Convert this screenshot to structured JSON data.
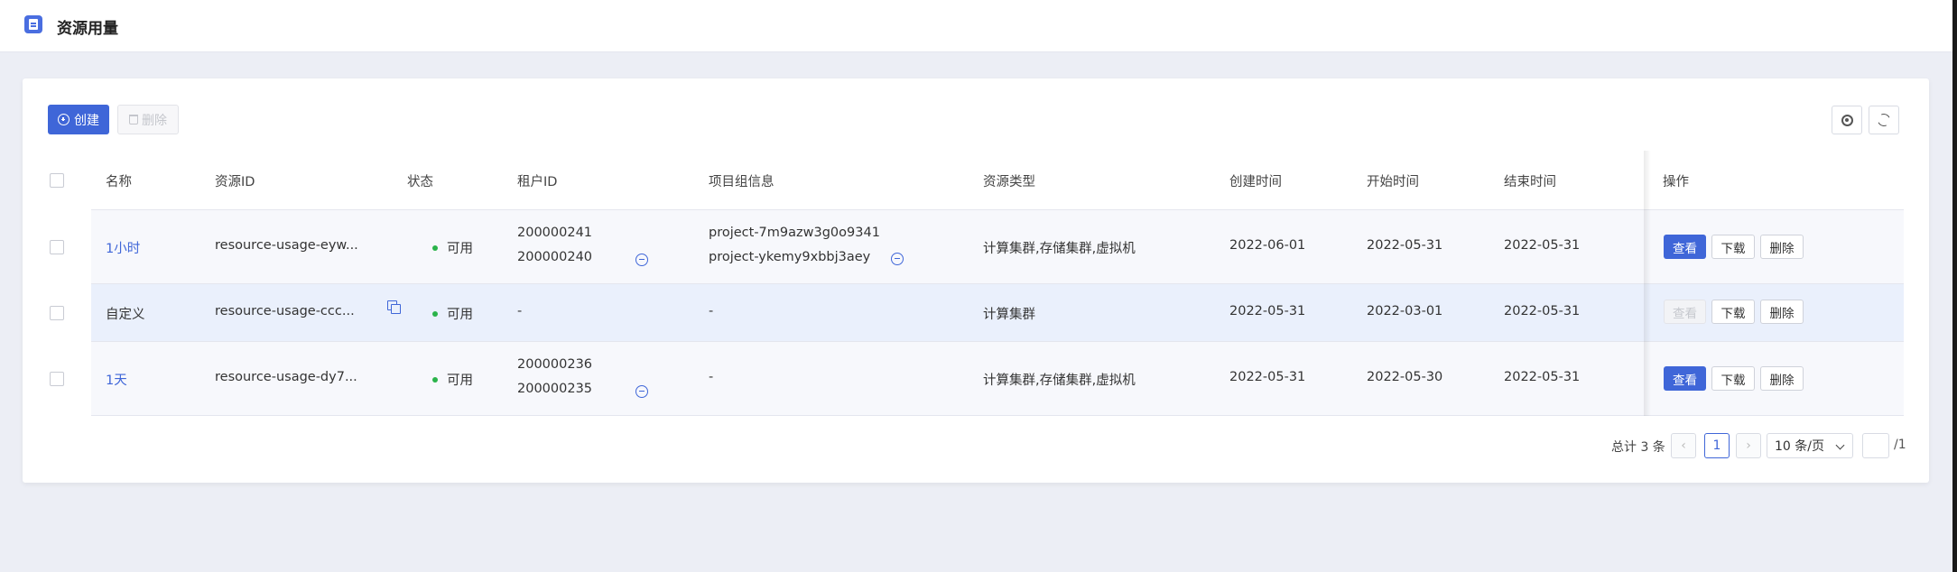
{
  "header": {
    "title": "资源用量"
  },
  "toolbar": {
    "create_label": "创建",
    "delete_label": "删除"
  },
  "columns": [
    "名称",
    "资源ID",
    "状态",
    "租户ID",
    "项目组信息",
    "资源类型",
    "创建时间",
    "开始时间",
    "结束时间",
    "操作"
  ],
  "rows": [
    {
      "name": "1小时",
      "resource_id": "resource-usage-eyw...",
      "status": "可用",
      "tenant_ids": [
        "200000241",
        "200000240"
      ],
      "projects": [
        "project-7m9azw3g0o9341",
        "project-ykemy9xbbj3aey"
      ],
      "resource_type": "计算集群,存储集群,虚拟机",
      "created": "2022-06-01",
      "start": "2022-05-31",
      "end": "2022-05-31"
    },
    {
      "name": "自定义",
      "resource_id": "resource-usage-ccc...",
      "status": "可用",
      "tenant_ids": [
        "-"
      ],
      "projects": [
        "-"
      ],
      "resource_type": "计算集群",
      "created": "2022-05-31",
      "start": "2022-03-01",
      "end": "2022-05-31"
    },
    {
      "name": "1天",
      "resource_id": "resource-usage-dy7...",
      "status": "可用",
      "tenant_ids": [
        "200000236",
        "200000235"
      ],
      "projects": [
        "-"
      ],
      "resource_type": "计算集群,存储集群,虚拟机",
      "created": "2022-05-31",
      "start": "2022-05-30",
      "end": "2022-05-31"
    }
  ],
  "actions": {
    "view": "查看",
    "download": "下载",
    "delete": "删除"
  },
  "pagination": {
    "total_label": "总计 3 条",
    "prev": "‹",
    "next": "›",
    "current_page": "1",
    "page_size": "10 条/页",
    "page_count": "/1"
  },
  "colors": {
    "primary": "#3f66d8",
    "status_ok": "#2ab34a"
  }
}
